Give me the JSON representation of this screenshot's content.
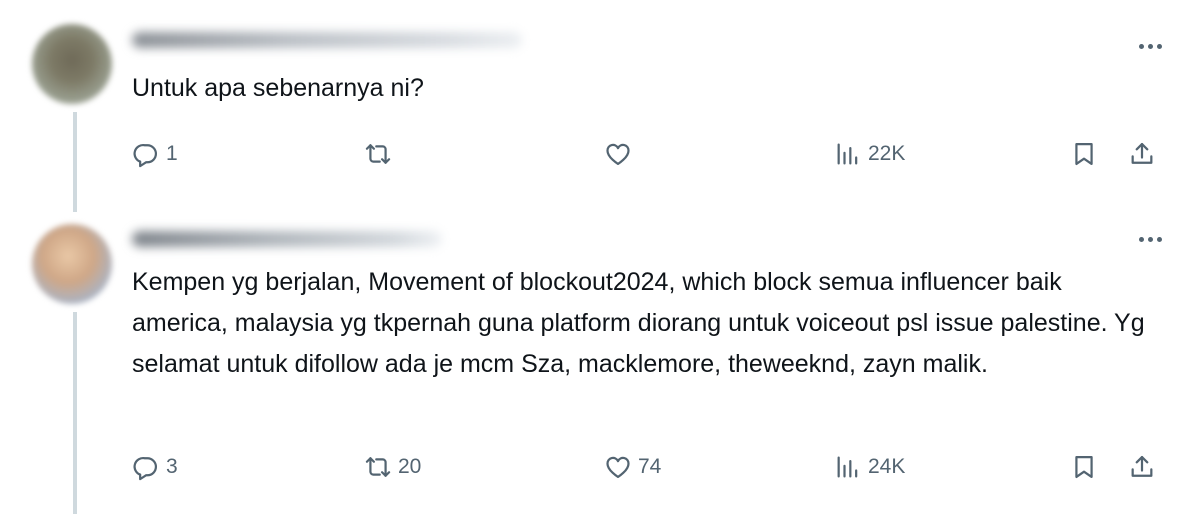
{
  "tweets": [
    {
      "text": "Untuk apa sebenarnya ni?",
      "actions": {
        "replies": "1",
        "retweets": "",
        "likes": "",
        "views": "22K"
      }
    },
    {
      "text": "Kempen yg berjalan, Movement of blockout2024, which block semua influencer baik america, malaysia yg tkpernah guna platform diorang untuk voiceout psl issue palestine. Yg selamat untuk difollow ada je mcm Sza, macklemore, theweeknd, zayn malik.",
      "actions": {
        "replies": "3",
        "retweets": "20",
        "likes": "74",
        "views": "24K"
      }
    }
  ],
  "icons": [
    "reply-icon",
    "retweet-icon",
    "like-icon",
    "views-icon",
    "bookmark-icon",
    "share-icon",
    "more-icon"
  ],
  "colors": {
    "text": "#0f1419",
    "secondary": "#536471",
    "thread_line": "#cfd9de",
    "background": "#ffffff"
  }
}
